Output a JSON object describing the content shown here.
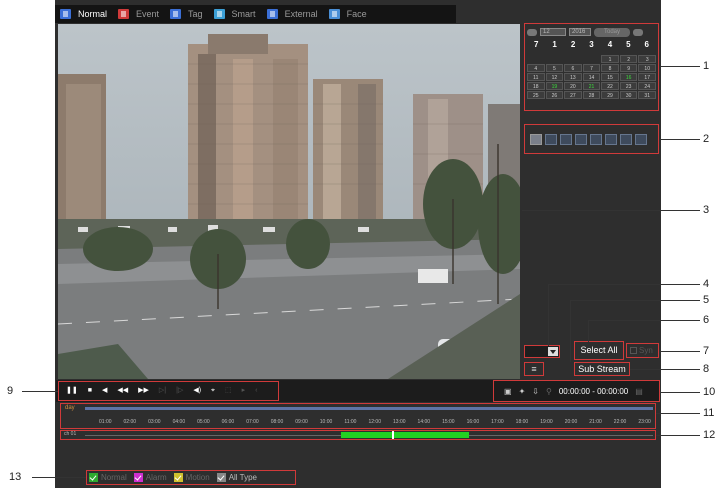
{
  "tabs": [
    {
      "label": "Normal",
      "icon": "normal-playback-icon",
      "color": "#3b6fd6",
      "active": true
    },
    {
      "label": "Event",
      "icon": "event-icon",
      "color": "#d03a3a",
      "active": false
    },
    {
      "label": "Tag",
      "icon": "tag-icon",
      "color": "#3b6fd6",
      "active": false
    },
    {
      "label": "Smart",
      "icon": "smart-icon",
      "color": "#3b9fd6",
      "active": false
    },
    {
      "label": "External",
      "icon": "external-icon",
      "color": "#3b6fd6",
      "active": false
    },
    {
      "label": "Face",
      "icon": "face-icon",
      "color": "#4a8fd6",
      "active": false
    }
  ],
  "calendar": {
    "month": "12",
    "year": "2016",
    "today_label": "Today",
    "weekdays": [
      "7",
      "1",
      "2",
      "3",
      "4",
      "5",
      "6"
    ],
    "leading_blanks": 4,
    "days": [
      "1",
      "2",
      "3",
      "4",
      "5",
      "6",
      "7",
      "8",
      "9",
      "10",
      "11",
      "12",
      "13",
      "14",
      "15",
      "16",
      "17",
      "18",
      "19",
      "20",
      "21",
      "22",
      "23",
      "24",
      "25",
      "26",
      "27",
      "28",
      "29",
      "30",
      "31"
    ],
    "recorded_days": [
      "16",
      "19",
      "21"
    ]
  },
  "channels": [
    "1",
    "2",
    "3",
    "4",
    "5",
    "6",
    "7",
    "8"
  ],
  "buttons": {
    "select_all": "Select All",
    "sub_stream": "Sub Stream",
    "syn": "Syn",
    "list_icon": "≡"
  },
  "playback_controls": [
    "pause-icon",
    "stop-icon",
    "reverse-play-icon",
    "rewind-icon",
    "fast-forward-icon",
    "slow-icon",
    "frame-step-icon",
    "volume-icon",
    "fullscreen-icon",
    "crop-icon",
    "play-next-icon",
    "marker-icon"
  ],
  "time_range": {
    "start": "00:00:00",
    "separator": "-",
    "end": "00:00:00"
  },
  "timeline": {
    "day_label": "day",
    "channel_label": "ch 01",
    "hours": [
      "01:00",
      "02:00",
      "03:00",
      "04:00",
      "05:00",
      "06:00",
      "07:00",
      "08:00",
      "09:00",
      "10:00",
      "11:00",
      "12:00",
      "13:00",
      "14:00",
      "15:00",
      "16:00",
      "17:00",
      "18:00",
      "19:00",
      "20:00",
      "21:00",
      "22:00",
      "23:00"
    ],
    "recording_fraction": 0.54
  },
  "legend": [
    {
      "label": "Normal",
      "color": "#2faa2f",
      "enabled": false
    },
    {
      "label": "Alarm",
      "color": "#d02fd0",
      "enabled": false
    },
    {
      "label": "Motion",
      "color": "#d0c02f",
      "enabled": false
    },
    {
      "label": "All Type",
      "color": "#888888",
      "enabled": true
    }
  ],
  "callouts": [
    "1",
    "2",
    "3",
    "4",
    "5",
    "6",
    "7",
    "8",
    "9",
    "10",
    "11",
    "12",
    "13"
  ]
}
